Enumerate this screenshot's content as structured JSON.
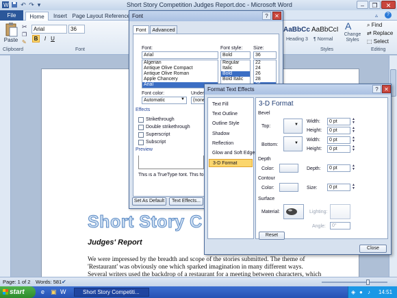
{
  "window": {
    "title": "Short Story Competition Judges Report.doc - Microsoft Word"
  },
  "ribbon_tabs": [
    "File",
    "Home",
    "Insert",
    "Page Layout",
    "Reference"
  ],
  "ribbon": {
    "paste_label": "Paste",
    "clipboard_label": "Clipboard",
    "font_name": "Arial",
    "font_size": "36",
    "font_group_label": "Font",
    "styles": [
      {
        "sample": "AaBbCc",
        "name": "Heading 3"
      },
      {
        "sample": "AaBbCcI",
        "name": "¶ Normal"
      }
    ],
    "change_styles_label": "Change Styles",
    "styles_group_label": "Styles",
    "editing": {
      "find": "Find",
      "replace": "Replace",
      "select": "Select",
      "label": "Editing"
    }
  },
  "font_dialog": {
    "title": "Font",
    "tabs": [
      "Font",
      "Advanced"
    ],
    "font_label": "Font:",
    "font_value": "Arial",
    "font_list": [
      "Algerian",
      "Antique Olive Compact",
      "Antique Olive Roman",
      "Apple Chancery",
      "Arial"
    ],
    "style_label": "Font style:",
    "style_value": "Bold",
    "style_list": [
      "Regular",
      "Italic",
      "Bold",
      "Bold Italic"
    ],
    "size_label": "Size:",
    "size_value": "36",
    "size_list": [
      "22",
      "24",
      "26",
      "28",
      "36"
    ],
    "color_label": "Font color:",
    "color_value": "Automatic",
    "underline_label": "Underli",
    "underline_value": "(none",
    "effects_label": "Effects",
    "effects": [
      "Strikethrough",
      "Double strikethrough",
      "Superscript",
      "Subscript"
    ],
    "preview_label": "Preview",
    "preview_note": "This is a TrueType font. This font w",
    "buttons": {
      "set_default": "Set As Default",
      "text_effects": "Text Effects..."
    }
  },
  "fx_dialog": {
    "title": "Format Text Effects",
    "categories": [
      "Text Fill",
      "Text Outline",
      "Outline Style",
      "Shadow",
      "Reflection",
      "Glow and Soft Edges",
      "3-D Format"
    ],
    "selected_category": "3-D Format",
    "panel_title": "3-D Format",
    "bevel_label": "Bevel",
    "top_label": "Top:",
    "bottom_label": "Bottom:",
    "width_label": "Width:",
    "height_label": "Height:",
    "top_width": "0 pt",
    "top_height": "0 pt",
    "bottom_width": "0 pt",
    "bottom_height": "0 pt",
    "depth_label": "Depth",
    "color_label": "Color:",
    "depth_value_label": "Depth:",
    "depth_value": "0 pt",
    "contour_label": "Contour",
    "size_label": "Size:",
    "contour_size": "0 pt",
    "surface_label": "Surface",
    "material_label": "Material:",
    "lighting_label": "Lighting:",
    "angle_label": "Angle:",
    "angle_value": "0°",
    "reset_label": "Reset",
    "close_label": "Close"
  },
  "document": {
    "heading": "Short Story C",
    "subheading": "Judges' Report",
    "lines": [
      "We were impressed by the breadth and scope of the stories submitted. The theme of",
      "'Restaurant' was obviously one which sparked imagination in many different ways.",
      "Several writers used the backdrop of a restaurant for a meeting between characters, which"
    ]
  },
  "status": {
    "page": "Page: 1 of 2",
    "words": "Words: 581"
  },
  "taskbar": {
    "start": "start",
    "task": "Short Story Competiti...",
    "clock": "14:51"
  }
}
